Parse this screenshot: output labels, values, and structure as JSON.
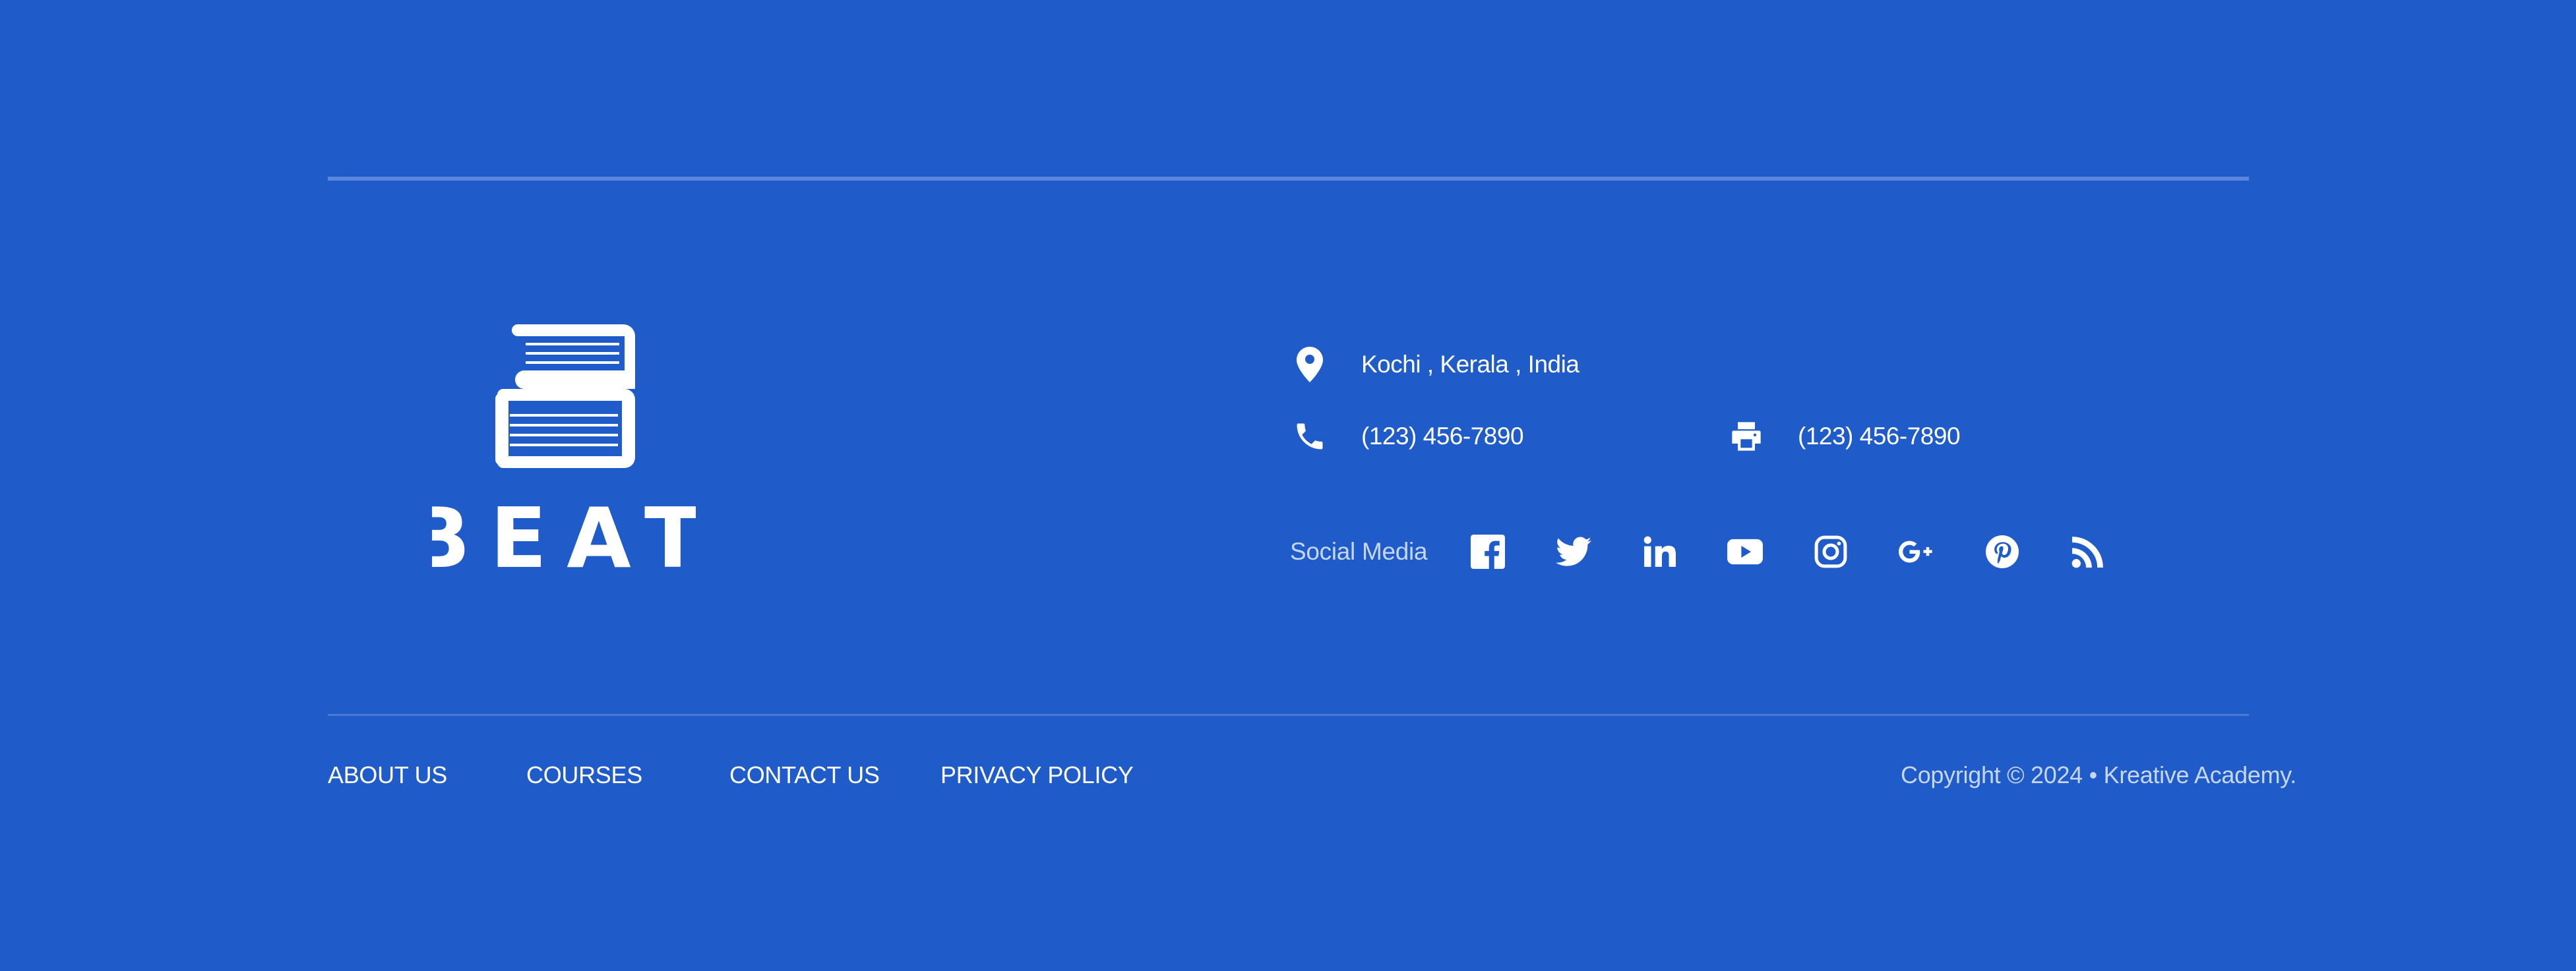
{
  "brand": {
    "logo_text": "BEAT",
    "logo_icon": "stacked-books-icon"
  },
  "contact": {
    "address": "Kochi , Kerala , India",
    "phone": "(123) 456-7890",
    "fax": "(123) 456-7890",
    "address_icon": "location-pin-icon",
    "phone_icon": "phone-icon",
    "fax_icon": "printer-icon"
  },
  "social": {
    "label": "Social Media",
    "icons": [
      "facebook-icon",
      "twitter-icon",
      "linkedin-icon",
      "youtube-icon",
      "instagram-icon",
      "google-plus-icon",
      "pinterest-icon",
      "rss-icon"
    ]
  },
  "footer_nav": {
    "about": "ABOUT US",
    "courses": "COURSES",
    "contact": "CONTACT US",
    "privacy": "PRIVACY POLICY"
  },
  "copyright": "Copyright © 2024 • Kreative Academy.",
  "colors": {
    "background": "#1f5cc9",
    "text": "#ffffff",
    "muted_text": "#c7d6f5",
    "divider": "#5a87dd"
  }
}
